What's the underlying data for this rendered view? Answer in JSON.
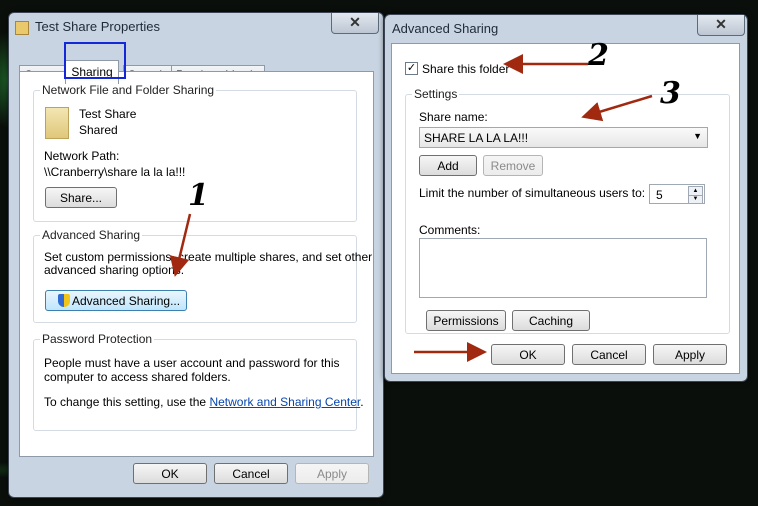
{
  "props_window": {
    "title": "Test Share Properties",
    "tabs": [
      "General",
      "Sharing",
      "Security",
      "Previous Versions"
    ],
    "network_group": {
      "title": "Network File and Folder Sharing",
      "folder_name": "Test Share",
      "folder_status": "Shared",
      "network_path_label": "Network Path:",
      "network_path": "\\\\Cranberry\\share la la la!!!",
      "share_button": "Share..."
    },
    "advanced_group": {
      "title": "Advanced Sharing",
      "description_line1": "Set custom permissions, create multiple shares, and set other",
      "description_line2": "advanced sharing options.",
      "advanced_button": "Advanced Sharing..."
    },
    "password_group": {
      "title": "Password Protection",
      "line1": "People must have a user account and password for this",
      "line2": "computer to access shared folders.",
      "change_prefix": "To change this setting, use the",
      "link": "Network and Sharing Center",
      "change_suffix": "."
    },
    "buttons": {
      "ok": "OK",
      "cancel": "Cancel",
      "apply": "Apply"
    }
  },
  "adv_window": {
    "title": "Advanced Sharing",
    "share_checkbox_label": "Share this folder",
    "share_checked": true,
    "settings_title": "Settings",
    "share_name_label": "Share name:",
    "share_name_value": "SHARE LA LA LA!!!",
    "add_button": "Add",
    "remove_button": "Remove",
    "limit_label": "Limit the number of simultaneous users to:",
    "limit_value": "5",
    "comments_label": "Comments:",
    "permissions_button": "Permissions",
    "caching_button": "Caching",
    "buttons": {
      "ok": "OK",
      "cancel": "Cancel",
      "apply": "Apply"
    }
  },
  "annotations": {
    "n1": "1",
    "n2": "2",
    "n3": "3"
  },
  "colors": {
    "arrow": "#a0290f",
    "tab_highlight": "#1328d8",
    "window_frame": "#c9d4e2"
  }
}
